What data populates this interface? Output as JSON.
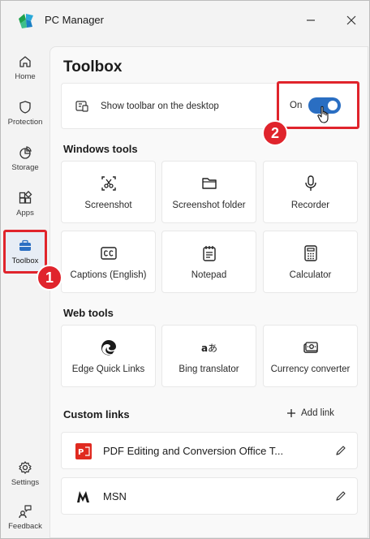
{
  "app": {
    "title": "PC Manager"
  },
  "sidebar": {
    "items": [
      {
        "label": "Home",
        "icon": "home-icon"
      },
      {
        "label": "Protection",
        "icon": "shield-icon"
      },
      {
        "label": "Storage",
        "icon": "pie-chart-icon"
      },
      {
        "label": "Apps",
        "icon": "apps-icon"
      },
      {
        "label": "Toolbox",
        "icon": "toolbox-icon",
        "active": true
      },
      {
        "label": "Settings",
        "icon": "gear-icon"
      },
      {
        "label": "Feedback",
        "icon": "feedback-icon"
      }
    ]
  },
  "main": {
    "title": "Toolbox",
    "toolbar_toggle": {
      "label": "Show toolbar on the desktop",
      "state_label": "On",
      "on": true
    },
    "windows_tools": {
      "title": "Windows tools",
      "items": [
        {
          "label": "Screenshot",
          "icon": "screenshot-icon"
        },
        {
          "label": "Screenshot folder",
          "icon": "folder-icon"
        },
        {
          "label": "Recorder",
          "icon": "microphone-icon"
        },
        {
          "label": "Captions (English)",
          "icon": "captions-icon"
        },
        {
          "label": "Notepad",
          "icon": "notepad-icon"
        },
        {
          "label": "Calculator",
          "icon": "calculator-icon"
        }
      ]
    },
    "web_tools": {
      "title": "Web tools",
      "items": [
        {
          "label": "Edge Quick Links",
          "icon": "edge-icon"
        },
        {
          "label": "Bing translator",
          "icon": "translate-icon"
        },
        {
          "label": "Currency converter",
          "icon": "currency-icon"
        }
      ]
    },
    "custom_links": {
      "title": "Custom links",
      "add_label": "Add link",
      "items": [
        {
          "label": "PDF Editing and Conversion Office T...",
          "icon": "pdf-icon"
        },
        {
          "label": "MSN",
          "icon": "msn-icon"
        }
      ]
    }
  },
  "annotations": [
    "1",
    "2"
  ],
  "colors": {
    "accent": "#2a6ec2",
    "highlight": "#e0242c"
  }
}
